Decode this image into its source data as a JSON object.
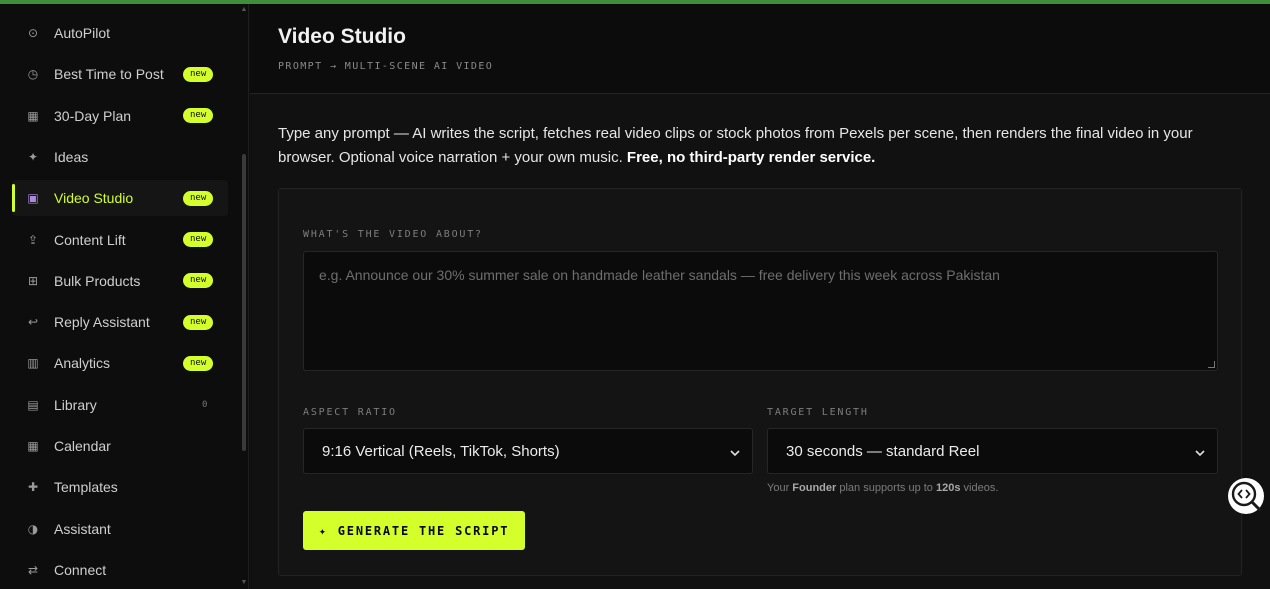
{
  "sidebar": {
    "items": [
      {
        "icon": "⊙",
        "label": "AutoPilot",
        "badge": "",
        "count": ""
      },
      {
        "icon": "◷",
        "label": "Best Time to Post",
        "badge": "new",
        "count": ""
      },
      {
        "icon": "▦",
        "label": "30-Day Plan",
        "badge": "new",
        "count": ""
      },
      {
        "icon": "✦",
        "label": "Ideas",
        "badge": "",
        "count": ""
      },
      {
        "icon": "▣",
        "label": "Video Studio",
        "badge": "new",
        "count": "",
        "active": true
      },
      {
        "icon": "⇪",
        "label": "Content Lift",
        "badge": "new",
        "count": ""
      },
      {
        "icon": "⊞",
        "label": "Bulk Products",
        "badge": "new",
        "count": ""
      },
      {
        "icon": "↩",
        "label": "Reply Assistant",
        "badge": "new",
        "count": ""
      },
      {
        "icon": "▥",
        "label": "Analytics",
        "badge": "new",
        "count": ""
      },
      {
        "icon": "▤",
        "label": "Library",
        "badge": "",
        "count": "0"
      },
      {
        "icon": "▦",
        "label": "Calendar",
        "badge": "",
        "count": ""
      },
      {
        "icon": "✚",
        "label": "Templates",
        "badge": "",
        "count": ""
      },
      {
        "icon": "◑",
        "label": "Assistant",
        "badge": "",
        "count": ""
      },
      {
        "icon": "⇄",
        "label": "Connect",
        "badge": "",
        "count": ""
      }
    ]
  },
  "header": {
    "title": "Video Studio",
    "subtitle": "PROMPT → MULTI-SCENE AI VIDEO"
  },
  "description": {
    "text": "Type any prompt — AI writes the script, fetches real video clips or stock photos from Pexels per scene, then renders the final video in your browser. Optional voice narration + your own music.",
    "bold": "Free, no third-party render service."
  },
  "form": {
    "prompt_label": "WHAT'S THE VIDEO ABOUT?",
    "prompt_placeholder": "e.g. Announce our 30% summer sale on handmade leather sandals — free delivery this week across Pakistan",
    "aspect_label": "ASPECT RATIO",
    "aspect_value": "9:16 Vertical (Reels, TikTok, Shorts)",
    "length_label": "TARGET LENGTH",
    "length_value": "30 seconds — standard Reel",
    "hint_prefix": "Your ",
    "hint_plan": "Founder",
    "hint_middle": " plan supports up to ",
    "hint_limit": "120s",
    "hint_suffix": " videos.",
    "generate_icon": "✦",
    "generate_label": "GENERATE THE SCRIPT"
  },
  "colors": {
    "accent": "#d4ff2a",
    "top_bar": "#3f8f3a",
    "background": "#111111"
  }
}
